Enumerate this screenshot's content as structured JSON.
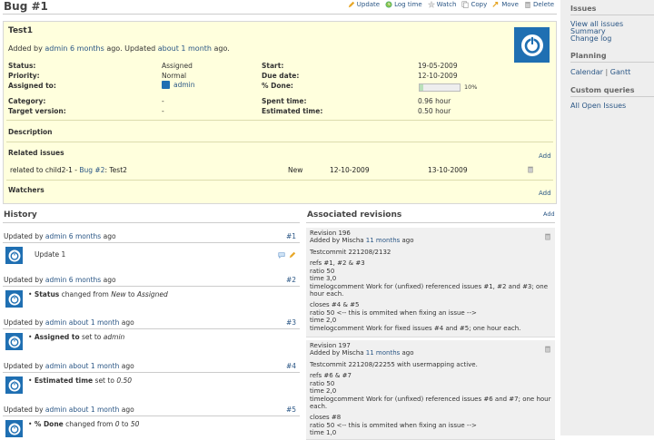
{
  "page": {
    "title": "Bug #1",
    "toolbar": {
      "update": "Update",
      "log_time": "Log time",
      "watch": "Watch",
      "copy": "Copy",
      "move": "Move",
      "delete": "Delete"
    }
  },
  "issue": {
    "subject": "Test1",
    "author_prefix": "Added by",
    "author": "admin",
    "created": "6 months",
    "ago_updated": "ago. Updated",
    "updated": "about 1 month",
    "ago_end": "ago.",
    "attrs": {
      "status_l": "Status:",
      "status_v": "Assigned",
      "priority_l": "Priority:",
      "priority_v": "Normal",
      "assigned_l": "Assigned to:",
      "assigned_v": "admin",
      "category_l": "Category:",
      "category_v": "-",
      "target_l": "Target version:",
      "target_v": "-",
      "start_l": "Start:",
      "start_v": "19-05-2009",
      "due_l": "Due date:",
      "due_v": "12-10-2009",
      "done_l": "% Done:",
      "done_v": "10%",
      "done_fraction": 0.1,
      "spent_l": "Spent time:",
      "spent_v": "0.96 hour",
      "est_l": "Estimated time:",
      "est_v": "0.50 hour"
    },
    "description_label": "Description",
    "related_label": "Related issues",
    "related_add": "Add",
    "related": {
      "prefix": "related to child2-1 - ",
      "link": "Bug #2",
      "suffix": ": Test2",
      "status": "New",
      "start": "12-10-2009",
      "due": "13-10-2009"
    },
    "watchers_label": "Watchers",
    "watchers_add": "Add"
  },
  "history": {
    "title": "History",
    "entries": [
      {
        "prefix": "Updated by",
        "user": "admin",
        "when": "6 months",
        "suffix": "ago",
        "num": "#1",
        "text": "Update 1"
      },
      {
        "prefix": "Updated by",
        "user": "admin",
        "when": "6 months",
        "suffix": "ago",
        "num": "#2",
        "field": "Status",
        "mid": " changed from ",
        "old": "New",
        "to": " to ",
        "new": "Assigned"
      },
      {
        "prefix": "Updated by",
        "user": "admin",
        "when": "about 1 month",
        "suffix": "ago",
        "num": "#3",
        "field": "Assigned to",
        "mid": " set to ",
        "new": "admin"
      },
      {
        "prefix": "Updated by",
        "user": "admin",
        "when": "about 1 month",
        "suffix": "ago",
        "num": "#4",
        "field": "Estimated time",
        "mid": " set to ",
        "new": "0.50"
      },
      {
        "prefix": "Updated by",
        "user": "admin",
        "when": "about 1 month",
        "suffix": "ago",
        "num": "#5",
        "field": "% Done",
        "mid": " changed from ",
        "old": "0",
        "to": " to ",
        "new": "50"
      }
    ]
  },
  "revisions": {
    "title": "Associated revisions",
    "add": "Add",
    "items": [
      {
        "rev": "Revision 196",
        "added": "Added by Mischa",
        "when": "11 months",
        "ago": "ago",
        "lines": [
          "Testcommit 221208/2132",
          "",
          "refs #1, #2 & #3",
          "ratio 50",
          "time 3,0",
          "timelogcomment Work for (unfixed) referenced issues #1, #2 and #3; one",
          "hour each.",
          "",
          "closes #4 & #5",
          "ratio 50 <-- this is ommited when fixing an issue -->",
          "time 2,0",
          "timelogcomment Work for fixed issues #4 and #5; one hour each."
        ]
      },
      {
        "rev": "Revision 197",
        "added": "Added by Mischa",
        "when": "11 months",
        "ago": "ago",
        "lines": [
          "Testcommit 221208/22255 with usermapping active.",
          "",
          "refs #6 & #7",
          "ratio 50",
          "time 2,0",
          "timelogcomment Work for (unfixed) referenced issues #6 and #7; one hour",
          "each.",
          "",
          "closes #8",
          "ratio 50 <-- this is ommited when fixing an issue -->",
          "time 1,0"
        ]
      }
    ]
  },
  "sidebar": {
    "issues_h": "Issues",
    "view_all": "View all issues",
    "summary": "Summary",
    "changelog": "Change log",
    "planning_h": "Planning",
    "calendar": "Calendar",
    "pipe": "|",
    "gantt": "Gantt",
    "custom_h": "Custom queries",
    "all_open": "All Open Issues"
  },
  "colors": {
    "issue_bg": "#ffffdd",
    "link": "#2a5685",
    "avatar": "#1f6fb2",
    "sidebar_bg": "#eeeeee"
  }
}
